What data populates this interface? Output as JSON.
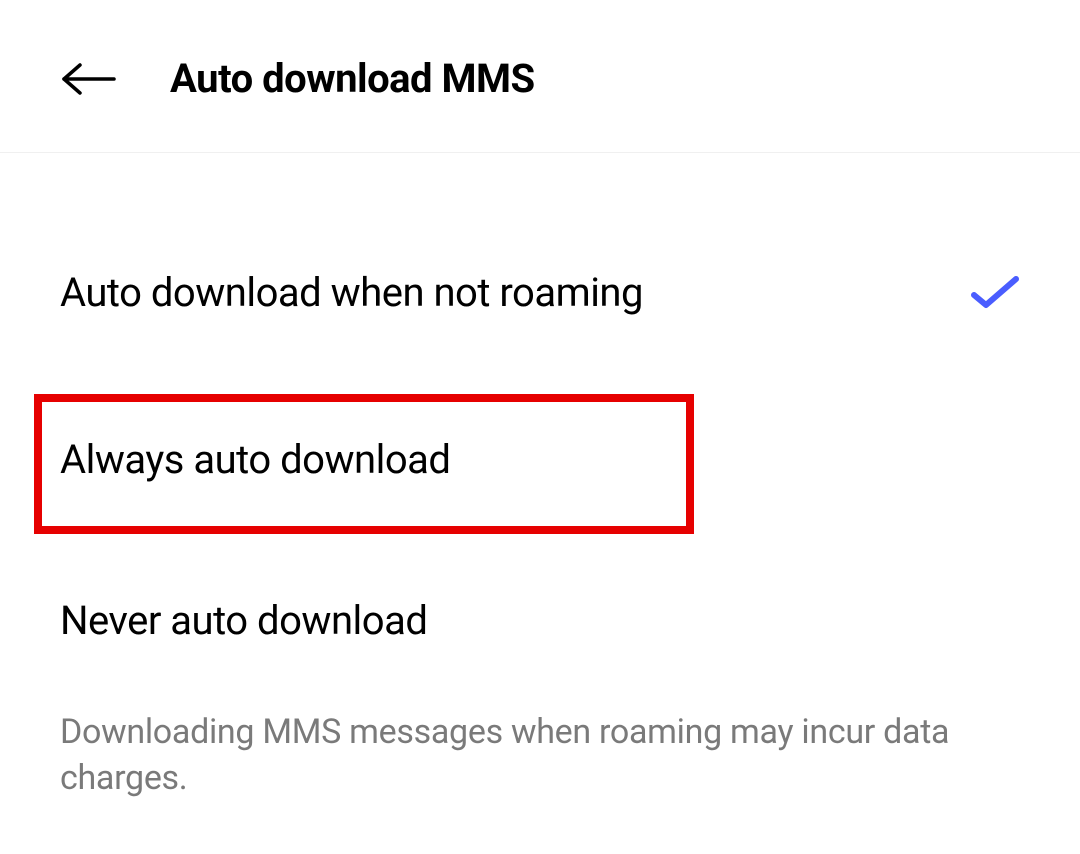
{
  "header": {
    "title": "Auto download MMS"
  },
  "options": {
    "items": [
      {
        "label": "Auto download when not roaming",
        "selected": true
      },
      {
        "label": "Always auto download",
        "selected": false
      },
      {
        "label": "Never auto download",
        "selected": false
      }
    ]
  },
  "footer": {
    "text": "Downloading MMS messages when roaming may incur data charges."
  },
  "colors": {
    "accent": "#4a5dff",
    "highlight": "#e60000"
  }
}
